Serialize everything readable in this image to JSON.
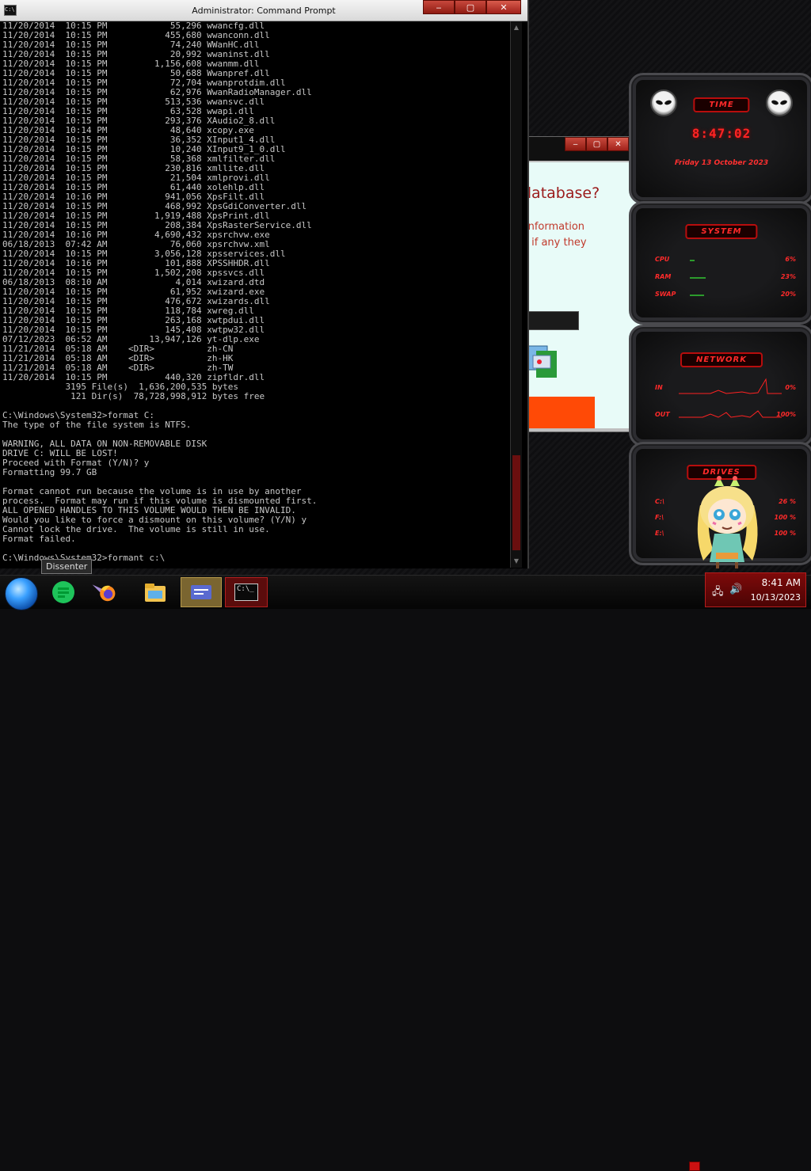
{
  "cmd": {
    "title": "Administrator: Command Prompt",
    "icon_label": "C:\\",
    "window_buttons": [
      "‒",
      "▢",
      "✕"
    ],
    "lines": [
      "11/20/2014  10:15 PM            55,296 wwancfg.dll",
      "11/20/2014  10:15 PM           455,680 wwanconn.dll",
      "11/20/2014  10:15 PM            74,240 WWanHC.dll",
      "11/20/2014  10:15 PM            20,992 wwaninst.dll",
      "11/20/2014  10:15 PM         1,156,608 wwanmm.dll",
      "11/20/2014  10:15 PM            50,688 Wwanpref.dll",
      "11/20/2014  10:15 PM            72,704 wwanprotdim.dll",
      "11/20/2014  10:15 PM            62,976 WwanRadioManager.dll",
      "11/20/2014  10:15 PM           513,536 wwansvc.dll",
      "11/20/2014  10:15 PM            63,528 wwapi.dll",
      "11/20/2014  10:15 PM           293,376 XAudio2_8.dll",
      "11/20/2014  10:14 PM            48,640 xcopy.exe",
      "11/20/2014  10:15 PM            36,352 XInput1_4.dll",
      "11/20/2014  10:15 PM            10,240 XInput9_1_0.dll",
      "11/20/2014  10:15 PM            58,368 xmlfilter.dll",
      "11/20/2014  10:15 PM           230,816 xmllite.dll",
      "11/20/2014  10:15 PM            21,504 xmlprovi.dll",
      "11/20/2014  10:15 PM            61,440 xolehlp.dll",
      "11/20/2014  10:16 PM           941,056 XpsFilt.dll",
      "11/20/2014  10:15 PM           468,992 XpsGdiConverter.dll",
      "11/20/2014  10:15 PM         1,919,488 XpsPrint.dll",
      "11/20/2014  10:15 PM           208,384 XpsRasterService.dll",
      "11/20/2014  10:16 PM         4,690,432 xpsrchvw.exe",
      "06/18/2013  07:42 AM            76,060 xpsrchvw.xml",
      "11/20/2014  10:15 PM         3,056,128 xpsservices.dll",
      "11/20/2014  10:16 PM           101,888 XPSSHHDR.dll",
      "11/20/2014  10:15 PM         1,502,208 xpssvcs.dll",
      "06/18/2013  08:10 AM             4,014 xwizard.dtd",
      "11/20/2014  10:15 PM            61,952 xwizard.exe",
      "11/20/2014  10:15 PM           476,672 xwizards.dll",
      "11/20/2014  10:15 PM           118,784 xwreg.dll",
      "11/20/2014  10:15 PM           263,168 xwtpdui.dll",
      "11/20/2014  10:15 PM           145,408 xwtpw32.dll",
      "07/12/2023  06:52 AM        13,947,126 yt-dlp.exe",
      "11/21/2014  05:18 AM    <DIR>          zh-CN",
      "11/21/2014  05:18 AM    <DIR>          zh-HK",
      "11/21/2014  05:18 AM    <DIR>          zh-TW",
      "11/20/2014  10:15 PM           440,320 zipfldr.dll",
      "            3195 File(s)  1,636,200,535 bytes",
      "             121 Dir(s)  78,728,998,912 bytes free",
      "",
      "C:\\Windows\\System32>format C:",
      "The type of the file system is NTFS.",
      "",
      "WARNING, ALL DATA ON NON-REMOVABLE DISK",
      "DRIVE C: WILL BE LOST!",
      "Proceed with Format (Y/N)? y",
      "Formatting 99.7 GB",
      "",
      "Format cannot run because the volume is in use by another",
      "process.  Format may run if this volume is dismounted first.",
      "ALL OPENED HANDLES TO THIS VOLUME WOULD THEN BE INVALID.",
      "Would you like to force a dismount on this volume? (Y/N) y",
      "Cannot lock the drive.  The volume is still in use.",
      "Format failed.",
      "",
      "C:\\Windows\\System32>formant c:\\"
    ]
  },
  "dialog": {
    "heading": "database?",
    "info_line1": "information",
    "info_line2": "e if any they",
    "window_buttons": [
      "‒",
      "▢",
      "✕"
    ]
  },
  "gadgets": {
    "time": {
      "header": "TIME",
      "clock": "8:47:02",
      "date": "Friday 13 October 2023"
    },
    "system": {
      "header": "SYSTEM",
      "rows": [
        {
          "label": "CPU",
          "value": "6%",
          "fill": 0.06
        },
        {
          "label": "RAM",
          "value": "23%",
          "fill": 0.23
        },
        {
          "label": "SWAP",
          "value": "20%",
          "fill": 0.2
        }
      ]
    },
    "network": {
      "header": "NETWORK",
      "rows": [
        {
          "label": "IN",
          "value": "0%"
        },
        {
          "label": "OUT",
          "value": "100%"
        }
      ]
    },
    "drives": {
      "header": "DRIVES",
      "rows": [
        {
          "label": "C:\\",
          "value": "26 %"
        },
        {
          "label": "F:\\",
          "value": "100 %"
        },
        {
          "label": "E:\\",
          "value": "100 %"
        }
      ]
    }
  },
  "taskbar": {
    "tooltip": "Dissenter",
    "apps": [
      "dissenter-browser-icon",
      "spotify-icon",
      "firefox-icon",
      "file-explorer-icon",
      "card-app-icon",
      "command-prompt-icon"
    ],
    "cmd_icon_label": "C:\\_"
  },
  "tray": {
    "time": "8:41 AM",
    "date": "10/13/2023"
  },
  "colors": {
    "accent_red": "#ff2424",
    "tray_red": "#7e0a0a",
    "orange_button": "#ff4a06"
  }
}
